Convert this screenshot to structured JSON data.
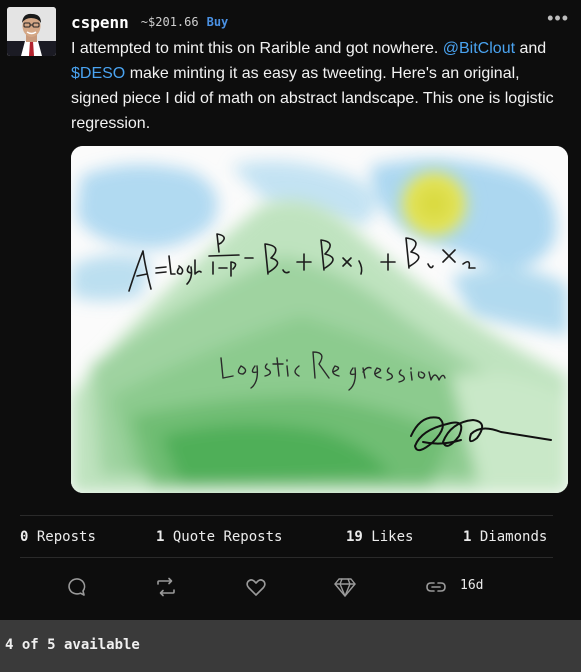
{
  "post": {
    "username": "cspenn",
    "price": "~$201.66",
    "buy_label": "Buy",
    "more_label": "•••",
    "text_part1": "I attempted to mint this on Rarible and got nowhere. ",
    "mention": "@BitClout",
    "text_part2": " and ",
    "ticker": "$DESO",
    "text_part3": " make minting it as easy as tweeting. Here's an original, signed piece I did of math on abstract landscape. This one is logistic regression.",
    "image": {
      "equation": "λ = log_b (p / 1−p) = β₀ + β₁x₁ + β₂x₂",
      "caption": "Logistic Regression"
    }
  },
  "stats": {
    "reposts_count": "0",
    "reposts_label": "Reposts",
    "quote_count": "1",
    "quote_label": "Quote Reposts",
    "likes_count": "19",
    "likes_label": "Likes",
    "diamonds_count": "1",
    "diamonds_label": "Diamonds"
  },
  "actions": {
    "icons": [
      "comment-icon",
      "repost-icon",
      "heart-icon",
      "diamond-icon",
      "link-icon"
    ],
    "age": "16d"
  },
  "footer": {
    "availability": "4 of 5 available"
  },
  "colors": {
    "background": "#0d0d0d",
    "link": "#4aa3f0",
    "buy": "#4a90e2",
    "footer": "#3a3a3a"
  }
}
